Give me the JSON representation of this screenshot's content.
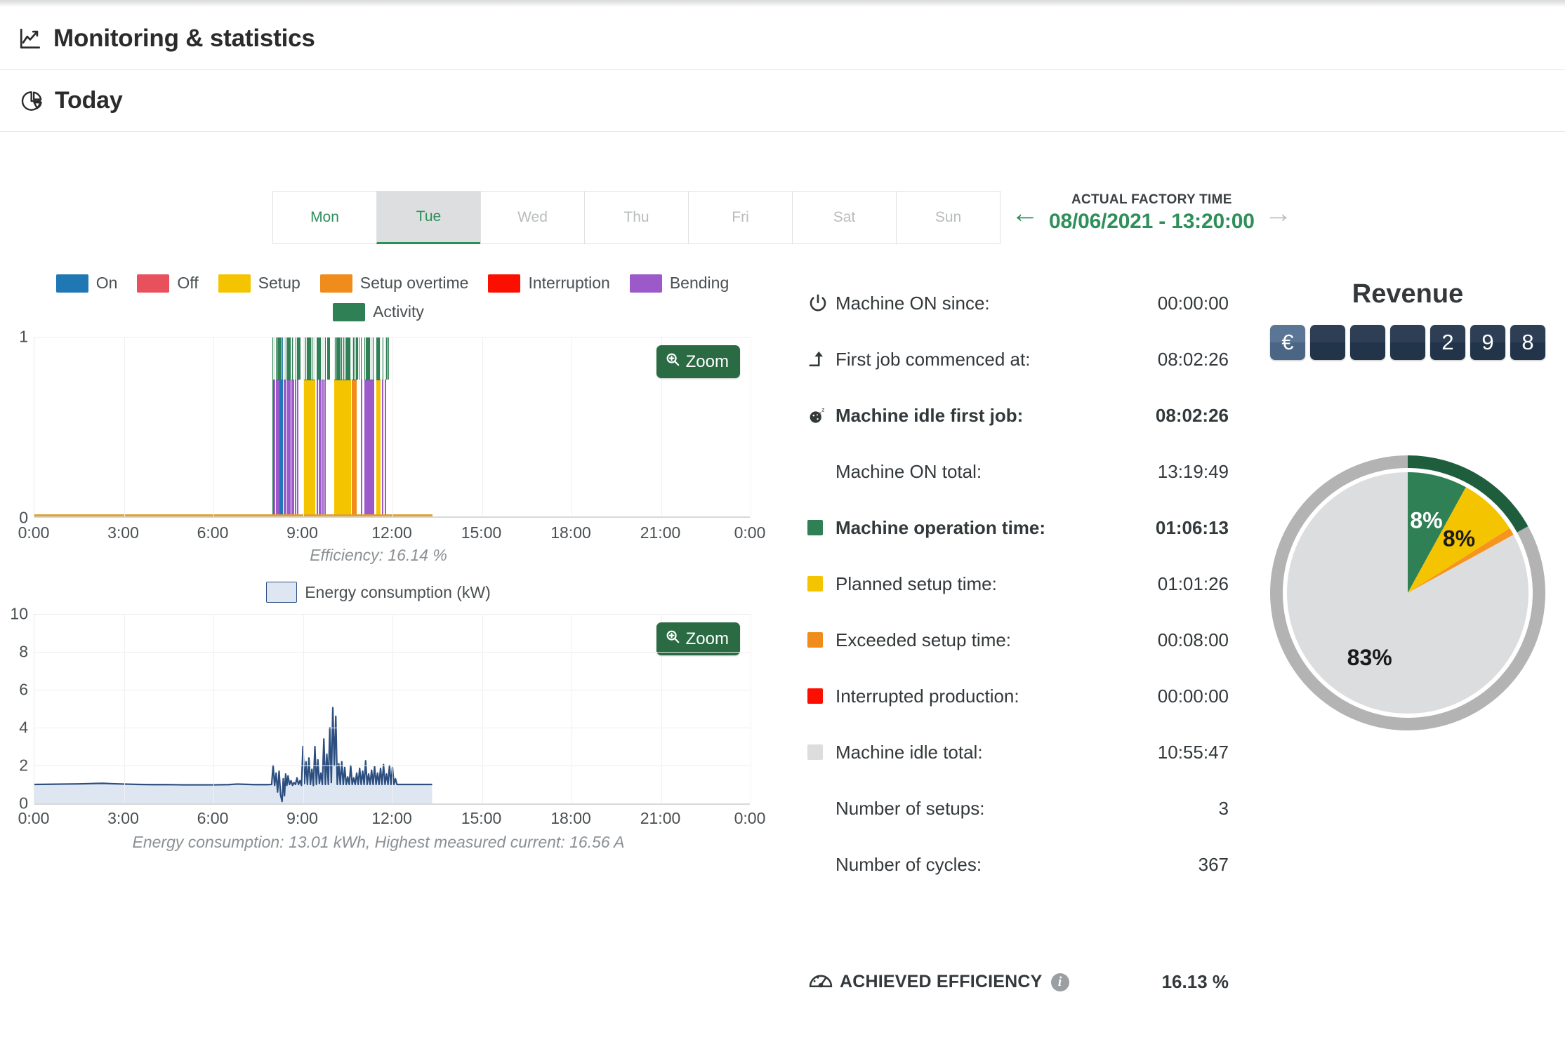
{
  "header": {
    "main_title": "Monitoring & statistics",
    "main_icon": "line-chart-icon",
    "sub_title": "Today",
    "sub_icon": "pie-chart-icon"
  },
  "day_tabs": {
    "items": [
      {
        "label": "Mon",
        "state": "enabled"
      },
      {
        "label": "Tue",
        "state": "selected"
      },
      {
        "label": "Wed",
        "state": "disabled"
      },
      {
        "label": "Thu",
        "state": "disabled"
      },
      {
        "label": "Fri",
        "state": "disabled"
      },
      {
        "label": "Sat",
        "state": "disabled"
      },
      {
        "label": "Sun",
        "state": "disabled"
      }
    ]
  },
  "factory_time": {
    "label": "ACTUAL FACTORY TIME",
    "value": "08/06/2021 - 13:20:00",
    "prev_icon": "arrow-left-icon",
    "next_icon": "arrow-right-icon"
  },
  "activity_chart": {
    "zoom_label": "Zoom",
    "zoom_icon": "magnifier-plus-icon",
    "caption": "Efficiency: 16.14 %",
    "legend": [
      {
        "label": "On",
        "color": "#1f77b4"
      },
      {
        "label": "Off",
        "color": "#e8505b"
      },
      {
        "label": "Setup",
        "color": "#f5c400"
      },
      {
        "label": "Setup overtime",
        "color": "#ef8c1b"
      },
      {
        "label": "Interruption",
        "color": "#fa0f00"
      },
      {
        "label": "Bending",
        "color": "#9b59c9"
      },
      {
        "label": "Activity",
        "color": "#2f8055"
      }
    ]
  },
  "energy_chart": {
    "zoom_label": "Zoom",
    "zoom_icon": "magnifier-plus-icon",
    "legend_label": "Energy consumption (kW)",
    "legend_fill": "#dee6f2",
    "legend_stroke": "#2c4f80",
    "caption": "Energy consumption: 13.01 kWh, Highest measured current: 16.56 A"
  },
  "stats": {
    "rows": [
      {
        "icon": "power-icon",
        "swatch": null,
        "label": "Machine ON since:",
        "value": "00:00:00",
        "bold": false
      },
      {
        "icon": "arrow-up-icon",
        "swatch": null,
        "label": "First job commenced at:",
        "value": "08:02:26",
        "bold": false
      },
      {
        "icon": "sleep-clock-icon",
        "swatch": null,
        "label": "Machine idle first job:",
        "value": "08:02:26",
        "bold": true
      },
      {
        "icon": null,
        "swatch": null,
        "label": "Machine ON total:",
        "value": "13:19:49",
        "bold": false
      },
      {
        "icon": null,
        "swatch": "#2f8055",
        "label": "Machine operation time:",
        "value": "01:06:13",
        "bold": true
      },
      {
        "icon": null,
        "swatch": "#f5c400",
        "label": "Planned setup time:",
        "value": "01:01:26",
        "bold": false
      },
      {
        "icon": null,
        "swatch": "#ef8c1b",
        "label": "Exceeded setup time:",
        "value": "00:08:00",
        "bold": false
      },
      {
        "icon": null,
        "swatch": "#fa0f00",
        "label": "Interrupted production:",
        "value": "00:00:00",
        "bold": false
      },
      {
        "icon": null,
        "swatch": "#dcdddf",
        "label": "Machine idle total:",
        "value": "10:55:47",
        "bold": false
      },
      {
        "icon": null,
        "swatch": null,
        "label": "Number of setups:",
        "value": "3",
        "bold": false
      },
      {
        "icon": null,
        "swatch": null,
        "label": "Number of cycles:",
        "value": "367",
        "bold": false
      }
    ],
    "efficiency": {
      "icon": "gauge-icon",
      "label": "ACHIEVED EFFICIENCY",
      "info_icon": "info-icon",
      "info_glyph": "i",
      "value": "16.13 %"
    }
  },
  "revenue": {
    "title": "Revenue",
    "currency_symbol": "€",
    "digits": [
      "",
      "",
      "",
      "2",
      "9",
      "8"
    ],
    "tile_color": "#2e3f55",
    "currency_tile_color": "#5a7596"
  },
  "chart_data": [
    {
      "type": "bar",
      "name": "machine-activity-timeline",
      "title": "",
      "xlabel": "",
      "ylabel": "",
      "ylim": [
        0,
        1
      ],
      "xlim": [
        0,
        24
      ],
      "grid": true,
      "ytick_labels": [
        "0",
        "1"
      ],
      "xtick_labels": [
        "0:00",
        "3:00",
        "6:00",
        "9:00",
        "12:00",
        "15:00",
        "18:00",
        "21:00",
        "0:00"
      ],
      "xtick_values": [
        0,
        3,
        6,
        9,
        12,
        15,
        18,
        21,
        24
      ],
      "legend_position": "top",
      "annotation": "Efficiency: 16.14 %",
      "baseline_span": [
        0,
        13.33
      ],
      "baseline_color": "#e0a030",
      "series": [
        {
          "name": "Activity",
          "color": "#2f8055",
          "top_band": true
        },
        {
          "name": "On",
          "color": "#1f77b4"
        },
        {
          "name": "Bending",
          "color": "#9b59c9"
        },
        {
          "name": "Setup",
          "color": "#f5c400"
        },
        {
          "name": "Setup overtime",
          "color": "#ef8c1b"
        }
      ],
      "bars": [
        {
          "x0": 7.98,
          "x1": 8.02,
          "color": "#2f8055",
          "act": 1.0,
          "body": 0.0
        },
        {
          "x0": 8.03,
          "x1": 8.08,
          "color": "#9b59c9",
          "act": 0.24,
          "body": 0.76
        },
        {
          "x0": 8.09,
          "x1": 8.11,
          "color": "#9b59c9",
          "act": 0.24,
          "body": 0.76
        },
        {
          "x0": 8.12,
          "x1": 8.16,
          "color": "#9b59c9",
          "act": 0.24,
          "body": 0.76
        },
        {
          "x0": 8.17,
          "x1": 8.2,
          "color": "#9b59c9",
          "act": 0.24,
          "body": 0.76
        },
        {
          "x0": 8.22,
          "x1": 8.33,
          "color": "#1f77b4",
          "act": 1.0,
          "body": 0.0
        },
        {
          "x0": 8.35,
          "x1": 8.39,
          "color": "#9b59c9",
          "act": 0.24,
          "body": 0.76
        },
        {
          "x0": 8.41,
          "x1": 8.45,
          "color": "#9b59c9",
          "act": 0.24,
          "body": 0.76
        },
        {
          "x0": 8.47,
          "x1": 8.5,
          "color": "#9b59c9",
          "act": 0.24,
          "body": 0.76
        },
        {
          "x0": 8.52,
          "x1": 8.58,
          "color": "#9b59c9",
          "act": 0.24,
          "body": 0.76
        },
        {
          "x0": 8.6,
          "x1": 8.64,
          "color": "#9b59c9",
          "act": 0.24,
          "body": 0.76
        },
        {
          "x0": 8.66,
          "x1": 8.7,
          "color": "#9b59c9",
          "act": 0.24,
          "body": 0.76
        },
        {
          "x0": 8.72,
          "x1": 8.76,
          "color": "#9b59c9",
          "act": 0.24,
          "body": 0.76
        },
        {
          "x0": 8.8,
          "x1": 8.84,
          "color": "#9b59c9",
          "act": 0.24,
          "body": 0.76
        },
        {
          "x0": 9.0,
          "x1": 9.42,
          "color": "#f5c400",
          "act": 0.24,
          "body": 0.76
        },
        {
          "x0": 9.46,
          "x1": 9.5,
          "color": "#9b59c9",
          "act": 0.24,
          "body": 0.76
        },
        {
          "x0": 9.52,
          "x1": 9.56,
          "color": "#9b59c9",
          "act": 0.24,
          "body": 0.76
        },
        {
          "x0": 9.58,
          "x1": 9.62,
          "color": "#9b59c9",
          "act": 0.24,
          "body": 0.76
        },
        {
          "x0": 9.64,
          "x1": 9.69,
          "color": "#9b59c9",
          "act": 0.24,
          "body": 0.76
        },
        {
          "x0": 9.71,
          "x1": 9.75,
          "color": "#9b59c9",
          "act": 0.24,
          "body": 0.76
        },
        {
          "x0": 10.05,
          "x1": 10.62,
          "color": "#f5c400",
          "act": 0.24,
          "body": 0.76
        },
        {
          "x0": 10.63,
          "x1": 10.8,
          "color": "#ef8c1b",
          "act": 0.24,
          "body": 0.76
        },
        {
          "x0": 10.93,
          "x1": 10.97,
          "color": "#9b59c9",
          "act": 0.24,
          "body": 0.76
        },
        {
          "x0": 11.05,
          "x1": 11.38,
          "color": "#9b59c9",
          "act": 0.24,
          "body": 0.76
        },
        {
          "x0": 11.45,
          "x1": 11.6,
          "color": "#f5c400",
          "act": 0.24,
          "body": 0.76
        },
        {
          "x0": 11.64,
          "x1": 11.7,
          "color": "#9b59c9",
          "act": 0.24,
          "body": 0.76
        },
        {
          "x0": 11.73,
          "x1": 11.78,
          "color": "#9b59c9",
          "act": 0.24,
          "body": 0.76
        }
      ]
    },
    {
      "type": "area",
      "name": "energy-consumption",
      "title": "",
      "xlabel": "",
      "ylabel": "",
      "unit": "kW",
      "ylim": [
        0,
        10
      ],
      "xlim": [
        0,
        24
      ],
      "grid": true,
      "legend_position": "top",
      "legend_entry": "Energy consumption (kW)",
      "ytick_labels": [
        "0",
        "2",
        "4",
        "6",
        "8",
        "10"
      ],
      "ytick_values": [
        0,
        2,
        4,
        6,
        8,
        10
      ],
      "xtick_labels": [
        "0:00",
        "3:00",
        "6:00",
        "9:00",
        "12:00",
        "15:00",
        "18:00",
        "21:00",
        "0:00"
      ],
      "xtick_values": [
        0,
        3,
        6,
        9,
        12,
        15,
        18,
        21,
        24
      ],
      "annotation": "Energy consumption: 13.01 kWh, Highest measured current: 16.56 A",
      "total_kwh": 13.01,
      "highest_current_a": 16.56,
      "peak_value": 5.05,
      "peak_time": 10.0,
      "data_end_time": 13.33,
      "baseline_value": 1.0,
      "points": [
        [
          0.0,
          1.0
        ],
        [
          0.5,
          1.01
        ],
        [
          1.0,
          1.02
        ],
        [
          1.5,
          1.03
        ],
        [
          2.0,
          1.05
        ],
        [
          2.3,
          1.06
        ],
        [
          2.6,
          1.04
        ],
        [
          3.0,
          1.02
        ],
        [
          3.5,
          1.0
        ],
        [
          4.0,
          0.99
        ],
        [
          4.5,
          0.99
        ],
        [
          5.0,
          0.98
        ],
        [
          5.5,
          0.98
        ],
        [
          6.0,
          0.98
        ],
        [
          6.5,
          0.99
        ],
        [
          6.8,
          1.02
        ],
        [
          7.0,
          1.01
        ],
        [
          7.4,
          0.99
        ],
        [
          7.8,
          0.99
        ],
        [
          7.95,
          1.0
        ],
        [
          8.0,
          2.0
        ],
        [
          8.05,
          0.95
        ],
        [
          8.1,
          1.6
        ],
        [
          8.15,
          0.6
        ],
        [
          8.2,
          1.7
        ],
        [
          8.25,
          0.45
        ],
        [
          8.3,
          0.1
        ],
        [
          8.34,
          1.3
        ],
        [
          8.38,
          0.4
        ],
        [
          8.42,
          1.55
        ],
        [
          8.46,
          0.95
        ],
        [
          8.5,
          1.45
        ],
        [
          8.55,
          1.0
        ],
        [
          8.6,
          1.2
        ],
        [
          8.65,
          0.95
        ],
        [
          8.7,
          1.1
        ],
        [
          8.75,
          1.0
        ],
        [
          8.8,
          1.35
        ],
        [
          8.85,
          1.0
        ],
        [
          8.9,
          1.2
        ],
        [
          8.95,
          0.95
        ],
        [
          9.0,
          3.0
        ],
        [
          9.05,
          1.05
        ],
        [
          9.1,
          2.2
        ],
        [
          9.15,
          1.0
        ],
        [
          9.2,
          2.4
        ],
        [
          9.25,
          1.0
        ],
        [
          9.3,
          1.8
        ],
        [
          9.35,
          0.95
        ],
        [
          9.4,
          3.0
        ],
        [
          9.45,
          1.0
        ],
        [
          9.5,
          2.3
        ],
        [
          9.55,
          1.05
        ],
        [
          9.6,
          1.6
        ],
        [
          9.65,
          1.0
        ],
        [
          9.7,
          3.4
        ],
        [
          9.75,
          1.0
        ],
        [
          9.8,
          2.6
        ],
        [
          9.85,
          1.0
        ],
        [
          9.9,
          4.0
        ],
        [
          9.95,
          1.1
        ],
        [
          10.0,
          5.05
        ],
        [
          10.05,
          2.0
        ],
        [
          10.1,
          4.6
        ],
        [
          10.15,
          1.0
        ],
        [
          10.2,
          2.1
        ],
        [
          10.25,
          1.0
        ],
        [
          10.3,
          2.2
        ],
        [
          10.35,
          1.0
        ],
        [
          10.4,
          1.9
        ],
        [
          10.45,
          1.0
        ],
        [
          10.5,
          1.4
        ],
        [
          10.55,
          1.0
        ],
        [
          10.6,
          2.0
        ],
        [
          10.65,
          1.0
        ],
        [
          10.7,
          1.35
        ],
        [
          10.75,
          1.0
        ],
        [
          10.8,
          1.6
        ],
        [
          10.85,
          1.0
        ],
        [
          10.9,
          1.85
        ],
        [
          10.95,
          1.0
        ],
        [
          11.0,
          1.7
        ],
        [
          11.05,
          1.0
        ],
        [
          11.1,
          2.25
        ],
        [
          11.15,
          1.0
        ],
        [
          11.2,
          1.55
        ],
        [
          11.25,
          1.0
        ],
        [
          11.3,
          1.75
        ],
        [
          11.35,
          1.0
        ],
        [
          11.4,
          1.95
        ],
        [
          11.45,
          1.0
        ],
        [
          11.5,
          1.6
        ],
        [
          11.55,
          1.0
        ],
        [
          11.6,
          1.85
        ],
        [
          11.65,
          1.0
        ],
        [
          11.7,
          2.05
        ],
        [
          11.75,
          1.0
        ],
        [
          11.8,
          1.55
        ],
        [
          11.85,
          1.0
        ],
        [
          11.9,
          2.0
        ],
        [
          11.95,
          1.0
        ],
        [
          12.0,
          1.9
        ],
        [
          12.05,
          1.0
        ],
        [
          12.1,
          1.3
        ],
        [
          12.15,
          1.0
        ],
        [
          12.3,
          1.0
        ],
        [
          12.6,
          1.0
        ],
        [
          13.0,
          1.0
        ],
        [
          13.33,
          1.0
        ]
      ]
    },
    {
      "type": "pie",
      "name": "time-distribution-pie",
      "title": "",
      "labels": [
        "Machine operation time",
        "Planned setup time",
        "Exceeded setup time",
        "Machine idle total"
      ],
      "values": [
        8,
        8,
        1,
        83
      ],
      "display_labels": [
        "8%",
        "8%",
        "",
        "83%"
      ],
      "colors": [
        "#2f8055",
        "#f5c400",
        "#f5941e",
        "#dcdddf"
      ],
      "start_angle": 0,
      "ring": {
        "track_color": "#b3b3b3",
        "arc_color": "#1f5e3c",
        "arc_start": 0,
        "arc_end": 61
      }
    }
  ]
}
